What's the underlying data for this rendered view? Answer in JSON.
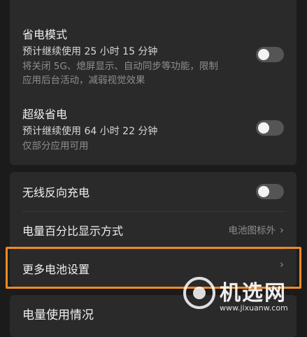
{
  "power_saving": {
    "title": "省电模式",
    "estimate": "预计继续使用 25 小时 15 分钟",
    "desc_line1": "将关闭 5G、熄屏显示、自动同步等功能，限制",
    "desc_line2": "应用后台活动，减弱视觉效果",
    "enabled": false
  },
  "ultra_power_saving": {
    "title": "超级省电",
    "estimate": "预计继续使用 64 小时 22 分钟",
    "desc": "仅部分应用可用",
    "enabled": false
  },
  "wireless_reverse_charging": {
    "title": "无线反向充电",
    "enabled": false
  },
  "battery_percentage": {
    "title": "电量百分比显示方式",
    "value": "电池图标外"
  },
  "more_battery_settings": {
    "title": "更多电池设置"
  },
  "battery_usage": {
    "title": "电量使用情况"
  },
  "watermark": {
    "brand": "机选网",
    "url": "www.jixuanw.com"
  },
  "colors": {
    "highlight": "#f08a24",
    "toggle_off": "#555555"
  }
}
